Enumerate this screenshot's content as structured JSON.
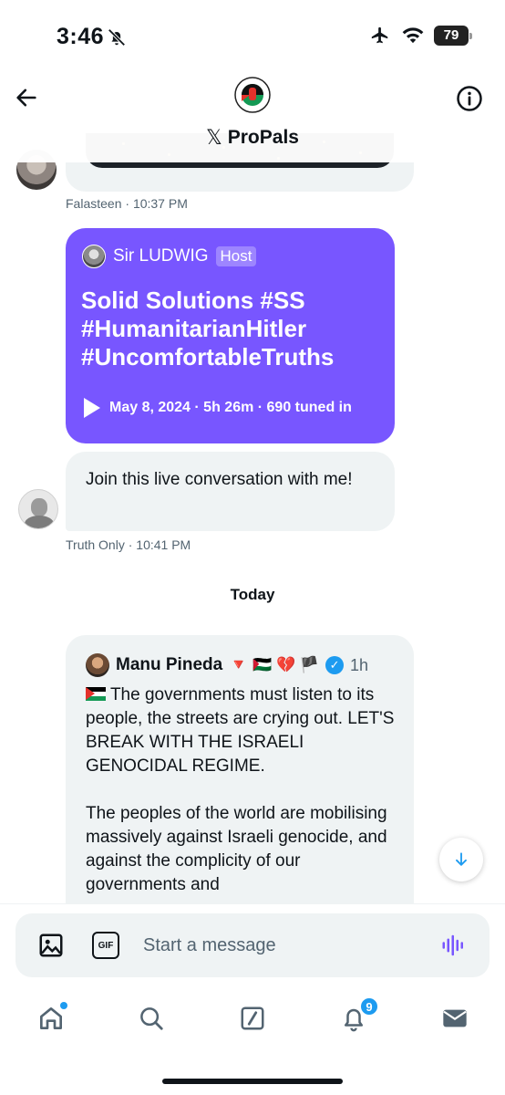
{
  "status_bar": {
    "time": "3:46",
    "battery": "79"
  },
  "header": {
    "x_glyph": "𝕏",
    "group_name": "ProPals"
  },
  "messages": [
    {
      "sender": "Falasteen",
      "time": "10:37 PM"
    },
    {
      "sender": "Truth Only",
      "time": "10:41 PM",
      "text": "Join this live conversation with me!"
    }
  ],
  "space_card": {
    "host_name": "Sir LUDWIG",
    "host_badge": "Host",
    "title": "Solid Solutions #SS #HumanitarianHitler #UncomfortableTruths",
    "meta": "May 8, 2024 · 5h 26m · 690 tuned in"
  },
  "day_separator": "Today",
  "quoted_tweet": {
    "author": "Manu Pineda",
    "name_emojis": "🔻 🇵🇸 💔 🏴",
    "time": "1h",
    "paragraph_1": "The governments must listen to its people, the streets are crying out. LET'S BREAK WITH THE ISRAELI GENOCIDAL REGIME.",
    "paragraph_2": "The peoples of the world are mobilising massively against Israeli genocide, and against the complicity of our governments and"
  },
  "composer": {
    "placeholder": "Start a message"
  },
  "tabbar": {
    "notification_count": "9"
  },
  "colors": {
    "space_card": "#7856ff",
    "accent": "#1d9bf0",
    "bubble": "#eff3f4",
    "meta_text": "#536471"
  },
  "icons": [
    "bell-off-icon",
    "airplane-icon",
    "wifi-icon",
    "back-arrow-icon",
    "info-icon",
    "play-icon",
    "verified-icon",
    "arrow-down-icon",
    "image-icon",
    "gif-icon",
    "voice-icon",
    "home-icon",
    "search-icon",
    "grok-icon",
    "notifications-icon",
    "messages-icon"
  ]
}
